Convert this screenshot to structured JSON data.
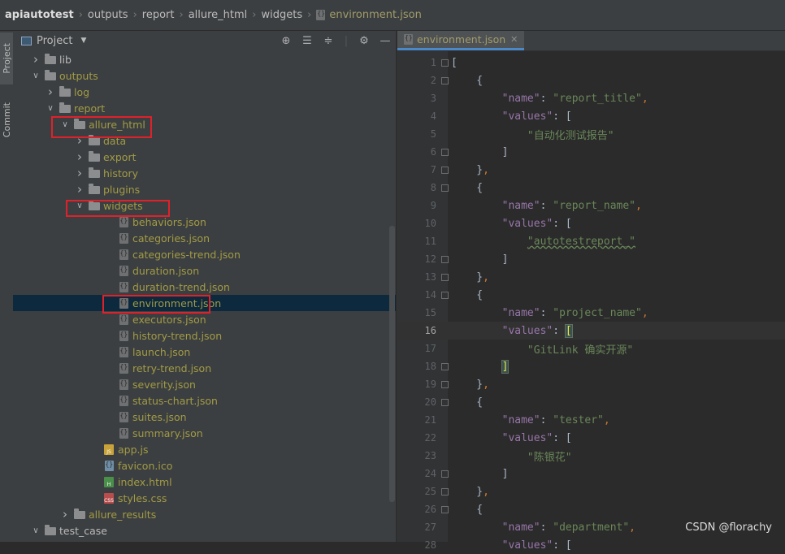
{
  "breadcrumb": [
    "apiautotest",
    "outputs",
    "report",
    "allure_html",
    "widgets",
    "environment.json"
  ],
  "tool_tabs": {
    "project": "Project",
    "commit": "Commit"
  },
  "panel": {
    "title": "Project"
  },
  "tree": [
    {
      "label": "lib",
      "type": "folder",
      "depth": 0,
      "arrow": "closed",
      "color": "folder"
    },
    {
      "label": "outputs",
      "type": "folder",
      "depth": 0,
      "arrow": "open",
      "color": "mod"
    },
    {
      "label": "log",
      "type": "folder",
      "depth": 1,
      "arrow": "closed",
      "color": "mod"
    },
    {
      "label": "report",
      "type": "folder",
      "depth": 1,
      "arrow": "open",
      "color": "mod"
    },
    {
      "label": "allure_html",
      "type": "folder",
      "depth": 2,
      "arrow": "open",
      "color": "mod"
    },
    {
      "label": "data",
      "type": "folder",
      "depth": 3,
      "arrow": "closed",
      "color": "mod"
    },
    {
      "label": "export",
      "type": "folder",
      "depth": 3,
      "arrow": "closed",
      "color": "mod"
    },
    {
      "label": "history",
      "type": "folder",
      "depth": 3,
      "arrow": "closed",
      "color": "mod"
    },
    {
      "label": "plugins",
      "type": "folder",
      "depth": 3,
      "arrow": "closed",
      "color": "mod"
    },
    {
      "label": "widgets",
      "type": "folder",
      "depth": 3,
      "arrow": "open",
      "color": "mod"
    },
    {
      "label": "behaviors.json",
      "type": "json",
      "depth": 5,
      "arrow": "none",
      "color": "mod"
    },
    {
      "label": "categories.json",
      "type": "json",
      "depth": 5,
      "arrow": "none",
      "color": "mod"
    },
    {
      "label": "categories-trend.json",
      "type": "json",
      "depth": 5,
      "arrow": "none",
      "color": "mod"
    },
    {
      "label": "duration.json",
      "type": "json",
      "depth": 5,
      "arrow": "none",
      "color": "mod"
    },
    {
      "label": "duration-trend.json",
      "type": "json",
      "depth": 5,
      "arrow": "none",
      "color": "mod"
    },
    {
      "label": "environment.json",
      "type": "json",
      "depth": 5,
      "arrow": "none",
      "color": "mod",
      "selected": true
    },
    {
      "label": "executors.json",
      "type": "json",
      "depth": 5,
      "arrow": "none",
      "color": "mod"
    },
    {
      "label": "history-trend.json",
      "type": "json",
      "depth": 5,
      "arrow": "none",
      "color": "mod"
    },
    {
      "label": "launch.json",
      "type": "json",
      "depth": 5,
      "arrow": "none",
      "color": "mod"
    },
    {
      "label": "retry-trend.json",
      "type": "json",
      "depth": 5,
      "arrow": "none",
      "color": "mod"
    },
    {
      "label": "severity.json",
      "type": "json",
      "depth": 5,
      "arrow": "none",
      "color": "mod"
    },
    {
      "label": "status-chart.json",
      "type": "json",
      "depth": 5,
      "arrow": "none",
      "color": "mod"
    },
    {
      "label": "suites.json",
      "type": "json",
      "depth": 5,
      "arrow": "none",
      "color": "mod"
    },
    {
      "label": "summary.json",
      "type": "json",
      "depth": 5,
      "arrow": "none",
      "color": "mod"
    },
    {
      "label": "app.js",
      "type": "js",
      "depth": 4,
      "arrow": "none",
      "color": "mod"
    },
    {
      "label": "favicon.ico",
      "type": "ico",
      "depth": 4,
      "arrow": "none",
      "color": "mod"
    },
    {
      "label": "index.html",
      "type": "html",
      "depth": 4,
      "arrow": "none",
      "color": "mod"
    },
    {
      "label": "styles.css",
      "type": "css",
      "depth": 4,
      "arrow": "none",
      "color": "mod"
    },
    {
      "label": "allure_results",
      "type": "folder",
      "depth": 2,
      "arrow": "closed",
      "color": "mod"
    },
    {
      "label": "test_case",
      "type": "folder",
      "depth": 0,
      "arrow": "open",
      "color": "folder"
    }
  ],
  "file_icon_text": {
    "js": "JS",
    "html": "H",
    "css": "CSS"
  },
  "editor": {
    "tab_label": "environment.json",
    "current_line": 16,
    "lines": [
      [
        [
          "br",
          "["
        ]
      ],
      [
        [
          "br",
          "    {"
        ]
      ],
      [
        [
          "br",
          "        "
        ],
        [
          "k",
          "\"name\""
        ],
        [
          "br",
          ": "
        ],
        [
          "s",
          "\"report_title\""
        ],
        [
          "p",
          ","
        ]
      ],
      [
        [
          "br",
          "        "
        ],
        [
          "k",
          "\"values\""
        ],
        [
          "br",
          ": ["
        ]
      ],
      [
        [
          "br",
          "            "
        ],
        [
          "s",
          "\"自动化测试报告\""
        ]
      ],
      [
        [
          "br",
          "        ]"
        ]
      ],
      [
        [
          "br",
          "    }"
        ],
        [
          "p",
          ","
        ]
      ],
      [
        [
          "br",
          "    {"
        ]
      ],
      [
        [
          "br",
          "        "
        ],
        [
          "k",
          "\"name\""
        ],
        [
          "br",
          ": "
        ],
        [
          "s",
          "\"report_name\""
        ],
        [
          "p",
          ","
        ]
      ],
      [
        [
          "br",
          "        "
        ],
        [
          "k",
          "\"values\""
        ],
        [
          "br",
          ": ["
        ]
      ],
      [
        [
          "br",
          "            "
        ],
        [
          "s",
          "\"autotestreport_\""
        ]
      ],
      [
        [
          "br",
          "        ]"
        ]
      ],
      [
        [
          "br",
          "    }"
        ],
        [
          "p",
          ","
        ]
      ],
      [
        [
          "br",
          "    {"
        ]
      ],
      [
        [
          "br",
          "        "
        ],
        [
          "k",
          "\"name\""
        ],
        [
          "br",
          ": "
        ],
        [
          "s",
          "\"project_name\""
        ],
        [
          "p",
          ","
        ]
      ],
      [
        [
          "br",
          "        "
        ],
        [
          "k",
          "\"values\""
        ],
        [
          "br",
          ": "
        ],
        [
          "brhl",
          "["
        ]
      ],
      [
        [
          "br",
          "            "
        ],
        [
          "s",
          "\"GitLink 确实开源\""
        ]
      ],
      [
        [
          "br",
          "        "
        ],
        [
          "brhl",
          "]"
        ]
      ],
      [
        [
          "br",
          "    }"
        ],
        [
          "p",
          ","
        ]
      ],
      [
        [
          "br",
          "    {"
        ]
      ],
      [
        [
          "br",
          "        "
        ],
        [
          "k",
          "\"name\""
        ],
        [
          "br",
          ": "
        ],
        [
          "s",
          "\"tester\""
        ],
        [
          "p",
          ","
        ]
      ],
      [
        [
          "br",
          "        "
        ],
        [
          "k",
          "\"values\""
        ],
        [
          "br",
          ": ["
        ]
      ],
      [
        [
          "br",
          "            "
        ],
        [
          "s",
          "\"陈银花\""
        ]
      ],
      [
        [
          "br",
          "        ]"
        ]
      ],
      [
        [
          "br",
          "    }"
        ],
        [
          "p",
          ","
        ]
      ],
      [
        [
          "br",
          "    {"
        ]
      ],
      [
        [
          "br",
          "        "
        ],
        [
          "k",
          "\"name\""
        ],
        [
          "br",
          ": "
        ],
        [
          "s",
          "\"department\""
        ],
        [
          "p",
          ","
        ]
      ],
      [
        [
          "br",
          "        "
        ],
        [
          "k",
          "\"values\""
        ],
        [
          "br",
          ": ["
        ]
      ]
    ]
  },
  "watermark": "CSDN @florachy",
  "colors": {
    "modified_file": "#a29b45",
    "selection": "#0d293e",
    "highlight_box": "#e0212a",
    "keyword": "#9876aa",
    "string": "#6a8759",
    "punct": "#cc7832"
  }
}
